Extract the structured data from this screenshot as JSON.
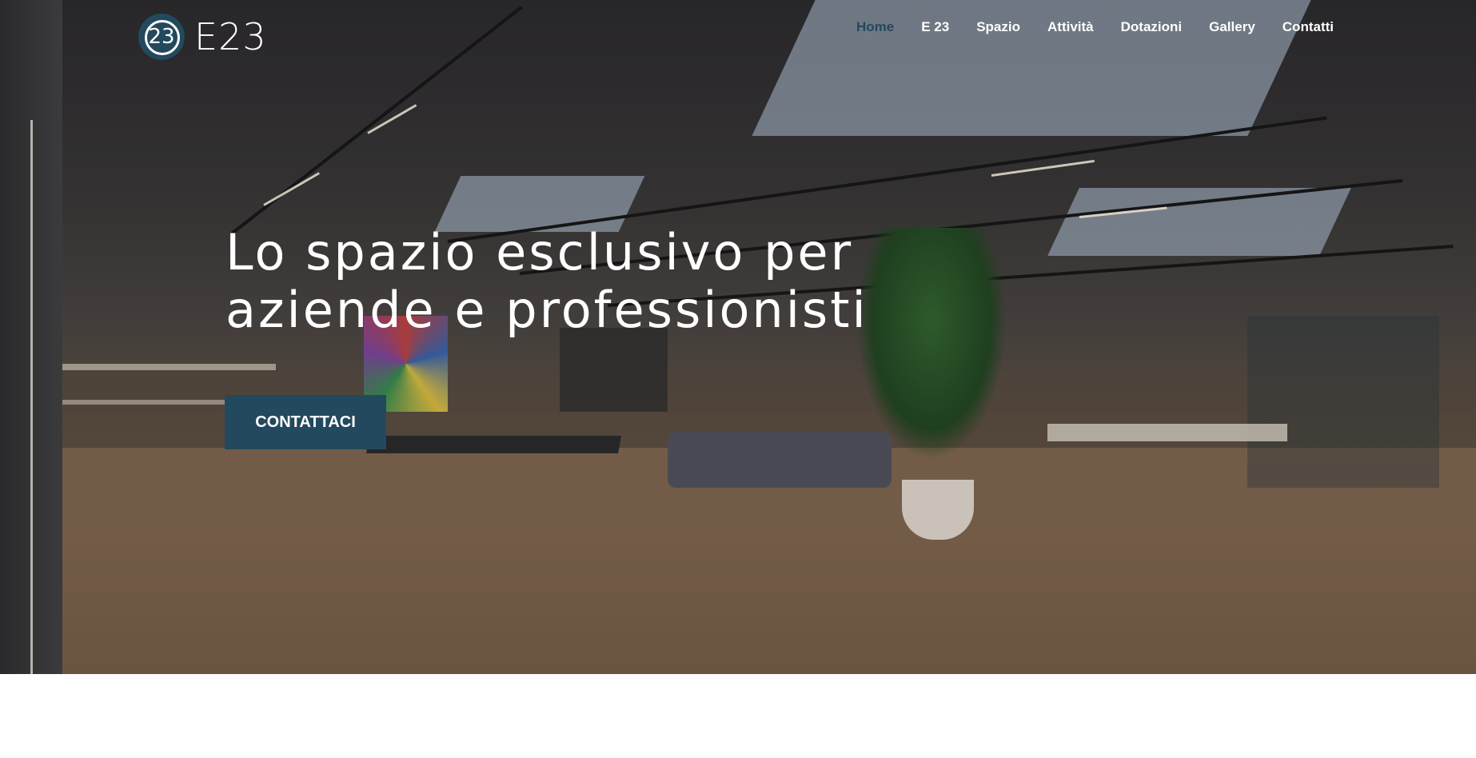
{
  "brand": {
    "name": "E23",
    "mark_text": "23",
    "accent": "#23495e"
  },
  "nav": {
    "items": [
      {
        "label": "Home",
        "active": true
      },
      {
        "label": "E 23"
      },
      {
        "label": "Spazio"
      },
      {
        "label": "Attività"
      },
      {
        "label": "Dotazioni"
      },
      {
        "label": "Gallery"
      },
      {
        "label": "Contatti"
      }
    ]
  },
  "hero": {
    "headline_line1": "Lo spazio esclusivo per",
    "headline_line2": "aziende e professionisti",
    "cta_label": "CONTATTACI"
  }
}
